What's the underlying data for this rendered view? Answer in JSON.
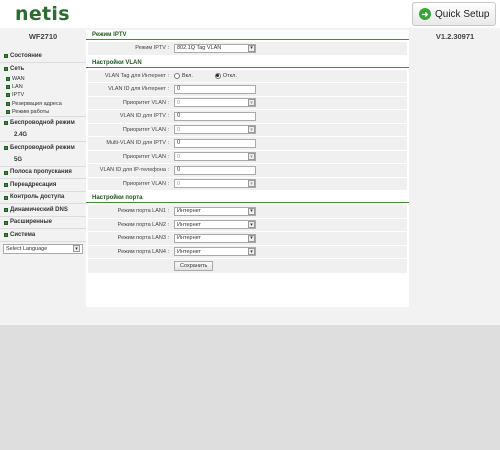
{
  "header": {
    "logo": "netis",
    "quick_setup": "Quick Setup"
  },
  "sidebar": {
    "model": "WF2710",
    "items": [
      {
        "label": "Состояние"
      },
      {
        "label": "Сеть"
      }
    ],
    "network_sub": [
      "WAN",
      "LAN",
      "IPTV",
      "Резервация адреса",
      "Режим работы"
    ],
    "items2": [
      {
        "label_1": "Беспроводной режим",
        "label_2": "2.4G"
      },
      {
        "label_1": "Беспроводной режим",
        "label_2": "5G"
      }
    ],
    "items3": [
      "Полоса пропускания",
      "Переадресация",
      "Контроль доступа",
      "Динамический DNS",
      "Расширенные",
      "Система"
    ],
    "language": "Select Language"
  },
  "version": "V1.2.30971",
  "iptv": {
    "title": "Режим IPTV",
    "mode_label": "Режим IPTV :",
    "mode_value": "802.1Q Tag VLAN"
  },
  "vlan": {
    "title": "Настройки VLAN",
    "tag_label": "VLAN Tag для Интернет :",
    "tag_on": "Вкл.",
    "tag_off": "Откл.",
    "rows": [
      {
        "label": "VLAN ID для Интернет :",
        "value": "0"
      },
      {
        "label": "Приоритет VLAN :",
        "value": "0"
      },
      {
        "label": "VLAN ID для IPTV :",
        "value": "0"
      },
      {
        "label": "Приоритет VLAN :",
        "value": "0"
      },
      {
        "label": "Multi-VLAN ID для IPTV :",
        "value": "0"
      },
      {
        "label": "Приоритет VLAN :",
        "value": "0"
      },
      {
        "label": "VLAN ID для IP-телефона :",
        "value": "0"
      },
      {
        "label": "Приоритет VLAN :",
        "value": "0"
      }
    ]
  },
  "ports": {
    "title": "Настройки порта",
    "rows": [
      {
        "label": "Режим порта LAN1 :",
        "value": "Интернет"
      },
      {
        "label": "Режим порта LAN2 :",
        "value": "Интернет"
      },
      {
        "label": "Режим порта LAN3 :",
        "value": "Интернет"
      },
      {
        "label": "Режим порта LAN4 :",
        "value": "Интернет"
      }
    ],
    "save": "Сохранить"
  },
  "colors": {
    "brand_green": "#2a6d2e",
    "section_title": "#1e5a1e"
  }
}
